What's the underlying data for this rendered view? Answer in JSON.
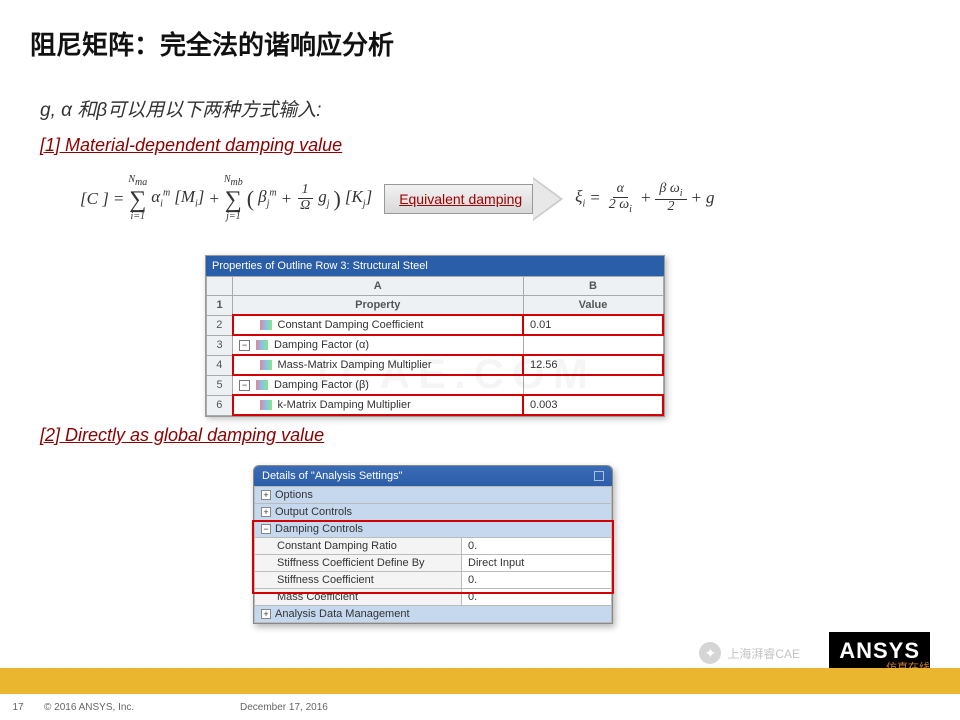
{
  "title": "阻尼矩阵：完全法的谐响应分析",
  "subtitle": "g, α 和β可以用以下两种方式输入:",
  "section1": "[1] Material-dependent damping value",
  "section2": "[2] Directly as global damping value",
  "arrow_label": "Equivalent damping",
  "panel1": {
    "title": "Properties of Outline Row 3: Structural Steel",
    "colA": "A",
    "colB": "B",
    "hdrProperty": "Property",
    "hdrValue": "Value",
    "rows": [
      {
        "n": "2",
        "label": "Constant Damping Coefficient",
        "value": "0.01",
        "hl": true,
        "icon": "prop"
      },
      {
        "n": "3",
        "label": "Damping Factor (α)",
        "value": "",
        "hl": false,
        "icon": "minus"
      },
      {
        "n": "4",
        "label": "Mass-Matrix Damping Multiplier",
        "value": "12.56",
        "hl": true,
        "icon": "prop"
      },
      {
        "n": "5",
        "label": "Damping Factor (β)",
        "value": "",
        "hl": false,
        "icon": "minus"
      },
      {
        "n": "6",
        "label": "k-Matrix Damping Multiplier",
        "value": "0.003",
        "hl": true,
        "icon": "prop"
      }
    ]
  },
  "panel2": {
    "title": "Details of \"Analysis Settings\"",
    "groups": [
      "Options",
      "Output Controls",
      "Damping Controls",
      "Analysis Data Management"
    ],
    "rows": [
      {
        "label": "Constant Damping Ratio",
        "value": "0."
      },
      {
        "label": "Stiffness Coefficient Define By",
        "value": "Direct Input"
      },
      {
        "label": "Stiffness Coefficient",
        "value": "0."
      },
      {
        "label": "Mass Coefficient",
        "value": "0."
      }
    ]
  },
  "footer": {
    "page": "17",
    "copyright": "© 2016 ANSYS, Inc.",
    "date": "December 17, 2016"
  },
  "logo": "ANSYS",
  "watermark_side": {
    "line1": "仿真在线",
    "line2": "www.1CAE.com"
  },
  "wechat_label": "上海湃睿CAE"
}
